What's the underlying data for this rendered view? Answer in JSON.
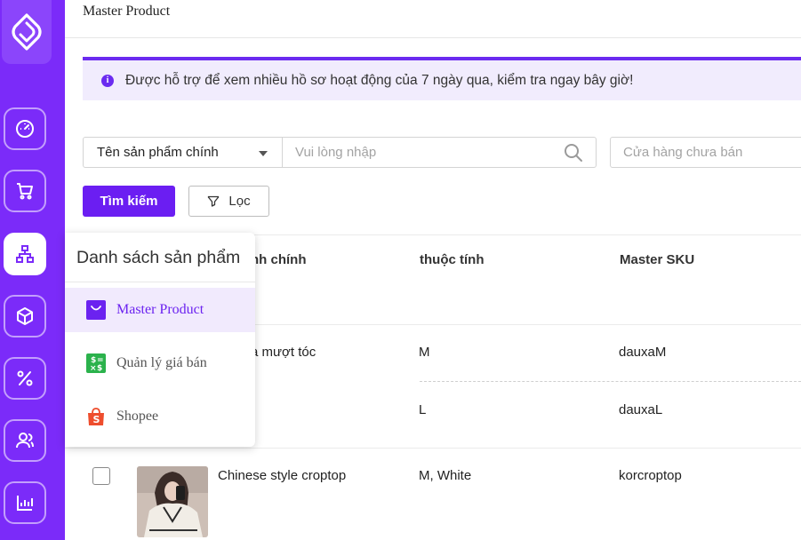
{
  "header": {
    "title": "Master Product"
  },
  "banner": {
    "text": "Được hỗ trợ để xem nhiều hồ sơ hoạt động của 7 ngày qua, kiểm tra ngay bây giờ!"
  },
  "search": {
    "field_select": "Tên sản phẩm chính",
    "input_placeholder": "Vui lòng nhập",
    "store_placeholder": "Cửa hàng chưa bán",
    "search_button": "Tìm kiếm",
    "filter_button": "Lọc"
  },
  "table": {
    "headers": [
      "nh chính",
      "thuộc tính",
      "Master SKU"
    ],
    "rows": [
      {
        "name": "à mượt tóc",
        "variants": [
          {
            "attribute": "M",
            "sku": "dauxaM"
          },
          {
            "attribute": "L",
            "sku": "dauxaL"
          }
        ]
      },
      {
        "name": "Chinese style croptop",
        "variants": [
          {
            "attribute": "M, White",
            "sku": "korcroptop"
          }
        ]
      }
    ]
  },
  "menu": {
    "title": "Danh sách sản phẩm",
    "items": [
      {
        "label": "Master Product",
        "icon": "shopping-bag-icon"
      },
      {
        "label": "Quản lý giá bán",
        "icon": "price-icon"
      },
      {
        "label": "Shopee",
        "icon": "shopee-icon"
      }
    ]
  },
  "sidebar": {
    "items": [
      "dashboard-icon",
      "cart-icon",
      "sitemap-icon",
      "box-icon",
      "percent-icon",
      "users-icon",
      "chart-icon"
    ]
  },
  "colors": {
    "brand": "#7b2bf9",
    "accent": "#6b1ef2",
    "banner_bg": "#f1ecfd",
    "shopee": "#ee4d2d",
    "price_green": "#2bb24c"
  }
}
